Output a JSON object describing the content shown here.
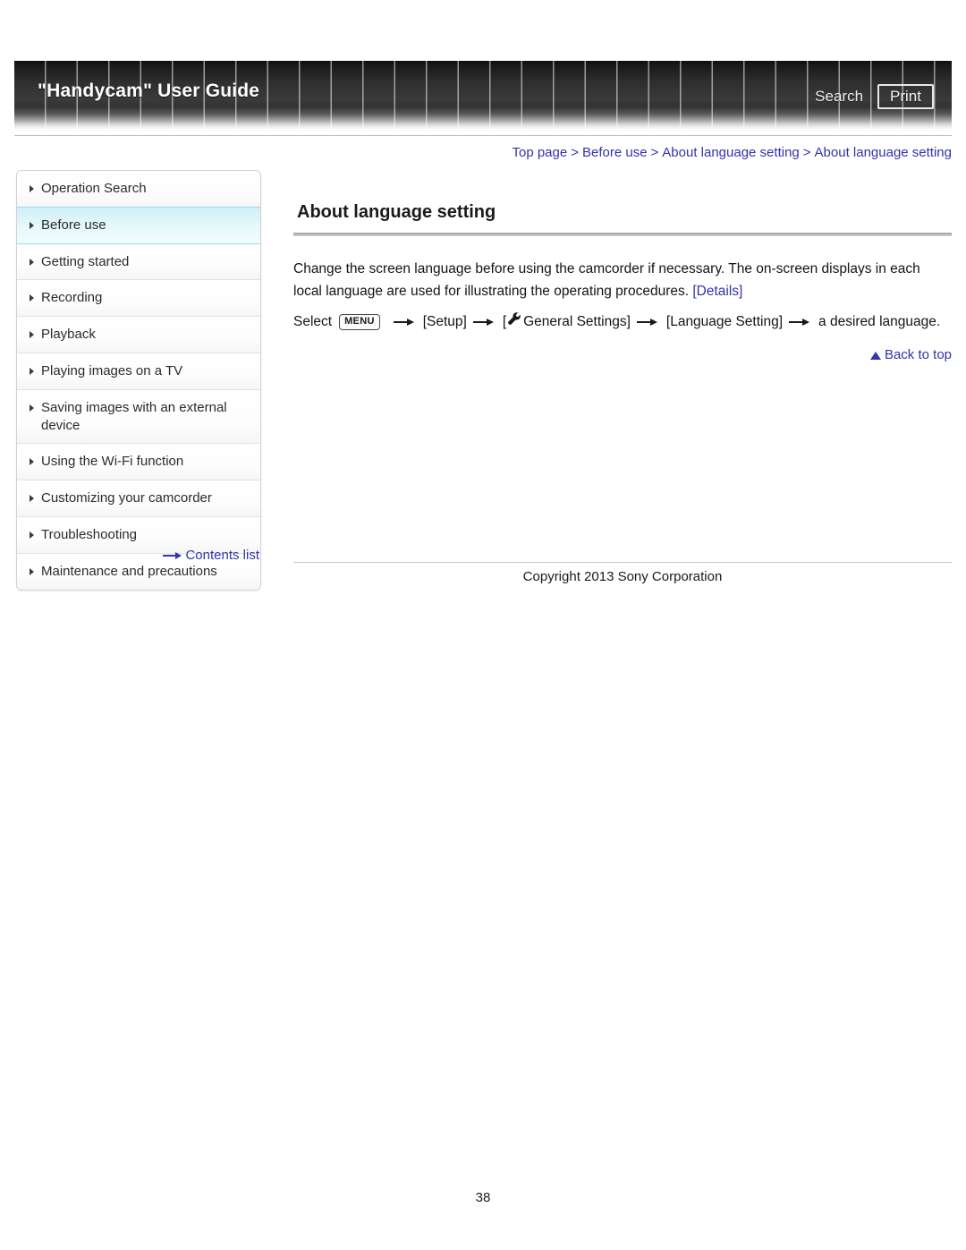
{
  "header": {
    "title": "\"Handycam\" User Guide",
    "search_label": "Search",
    "print_label": "Print"
  },
  "breadcrumb": {
    "items": [
      "Top page",
      "Before use",
      "About language setting",
      "About language setting"
    ],
    "separator": ">"
  },
  "sidebar": {
    "items": [
      {
        "label": "Operation Search",
        "active": false
      },
      {
        "label": "Before use",
        "active": true
      },
      {
        "label": "Getting started",
        "active": false
      },
      {
        "label": "Recording",
        "active": false
      },
      {
        "label": "Playback",
        "active": false
      },
      {
        "label": "Playing images on a TV",
        "active": false
      },
      {
        "label": "Saving images with an external device",
        "active": false
      },
      {
        "label": "Using the Wi-Fi function",
        "active": false
      },
      {
        "label": "Customizing your camcorder",
        "active": false
      },
      {
        "label": "Troubleshooting",
        "active": false
      },
      {
        "label": "Maintenance and precautions",
        "active": false
      }
    ],
    "contents_list_label": "Contents list"
  },
  "main": {
    "title": "About language setting",
    "paragraph_before_link": "Change the screen language before using the camcorder if necessary. The on-screen displays in each local language are used for illustrating the operating procedures. ",
    "details_link": "[Details]",
    "select_steps": {
      "select_label": "Select",
      "menu_chip": "MENU",
      "step_setup": "[Setup]",
      "step_general_open": "[",
      "step_general_label": "General Settings]",
      "step_language": "[Language Setting]",
      "step_final": "a desired language."
    },
    "back_to_top": "Back to top"
  },
  "footer": {
    "copyright": "Copyright 2013 Sony Corporation",
    "page_number": "38"
  },
  "colors": {
    "link": "#3333aa",
    "highlight": "#cdf0f7",
    "header_dark": "#2e2e2e"
  }
}
